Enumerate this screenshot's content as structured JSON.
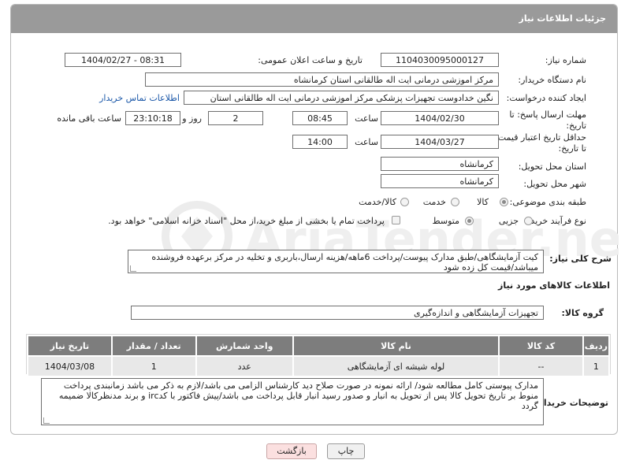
{
  "header": {
    "title": "جزئیات اطلاعات نیاز"
  },
  "fields": {
    "need_number_label": "شماره نیاز:",
    "need_number": "1104030095000127",
    "announce_label": "تاریخ و ساعت اعلان عمومی:",
    "announce_value": "1404/02/27 - 08:31",
    "buyer_org_label": "نام دستگاه خریدار:",
    "buyer_org": "مرکز اموزشی درمانی ایت اله طالقانی استان کرمانشاه",
    "creator_label": "ایجاد کننده درخواست:",
    "creator": "نگین خدادوست تجهیزات پزشکی مرکز اموزشی درمانی ایت اله طالقانی استان",
    "contact_link": "اطلاعات تماس خریدار",
    "deadline_label_1": "مهلت ارسال پاسخ: تا",
    "deadline_label_2": "تاریخ:",
    "deadline_date": "1404/02/30",
    "time_label": "ساعت",
    "deadline_time": "08:45",
    "days_value": "2",
    "days_label": "روز و",
    "remaining_time": "23:10:18",
    "remaining_label": "ساعت باقی مانده",
    "validity_label_1": "حداقل تاریخ اعتبار قیمت:",
    "validity_label_2": "تا تاریخ:",
    "validity_date": "1404/03/27",
    "validity_time": "14:00",
    "province_label": "استان محل تحویل:",
    "province": "کرمانشاه",
    "city_label": "شهر محل تحویل:",
    "city": "کرمانشاه",
    "category_label": "طبقه بندی موضوعی:",
    "category_options": [
      "کالا",
      "خدمت",
      "کالا/خدمت"
    ],
    "category_selected": "کالا",
    "process_label": "نوع فرآیند خرید :",
    "process_options": [
      "جزیی",
      "متوسط"
    ],
    "process_selected": "متوسط",
    "payment_note": "پرداخت تمام یا بخشی از مبلغ خرید،از محل \"اسناد خزانه اسلامی\" خواهد بود."
  },
  "description": {
    "label": "شرح کلی نیاز:",
    "text": "کیت آزمایشگاهی/طبق مدارک پیوست/پرداخت 6ماهه/هزینه ارسال،باربری و تخلیه در مرکز برعهده فروشنده میباشد/قیمت کل زده شود"
  },
  "goods": {
    "section_title": "اطلاعات کالاهای مورد نیاز",
    "group_label": "گروه کالا:",
    "group_value": "تجهیزات آزمایشگاهی و اندازه‌گیری",
    "columns": [
      "ردیف",
      "کد کالا",
      "نام کالا",
      "واحد شمارش",
      "تعداد / مقدار",
      "تاریخ نیاز"
    ],
    "rows": [
      {
        "row": "1",
        "code": "--",
        "name": "لوله شیشه ای آزمایشگاهی",
        "unit": "عدد",
        "qty": "1",
        "date": "1404/03/08"
      }
    ]
  },
  "buyer_notes": {
    "label": "توضیحات خریدار:",
    "text": "مدارک پیوستی کامل مطالعه شود/ ارائه نمونه در صورت صلاح دید کارشناس الزامی می باشد/لازم به ذکر می باشد زمانبندی پرداخت منوط بر تاریخ تحویل کالا  پس از تحویل به انبار و صدور رسید انبار قابل پرداخت می باشد/پیش فاکتور با کدirc و برند مدنظرکالا ضمیمه گردد"
  },
  "buttons": {
    "print": "چاپ",
    "back": "بازگشت"
  },
  "colors": {
    "header_bg": "#9a9a9a",
    "table_header_bg": "#7d7d7d",
    "row_bg": "#e8e8e8",
    "link": "#1a57a8",
    "back_bg": "#fbe0e0"
  }
}
